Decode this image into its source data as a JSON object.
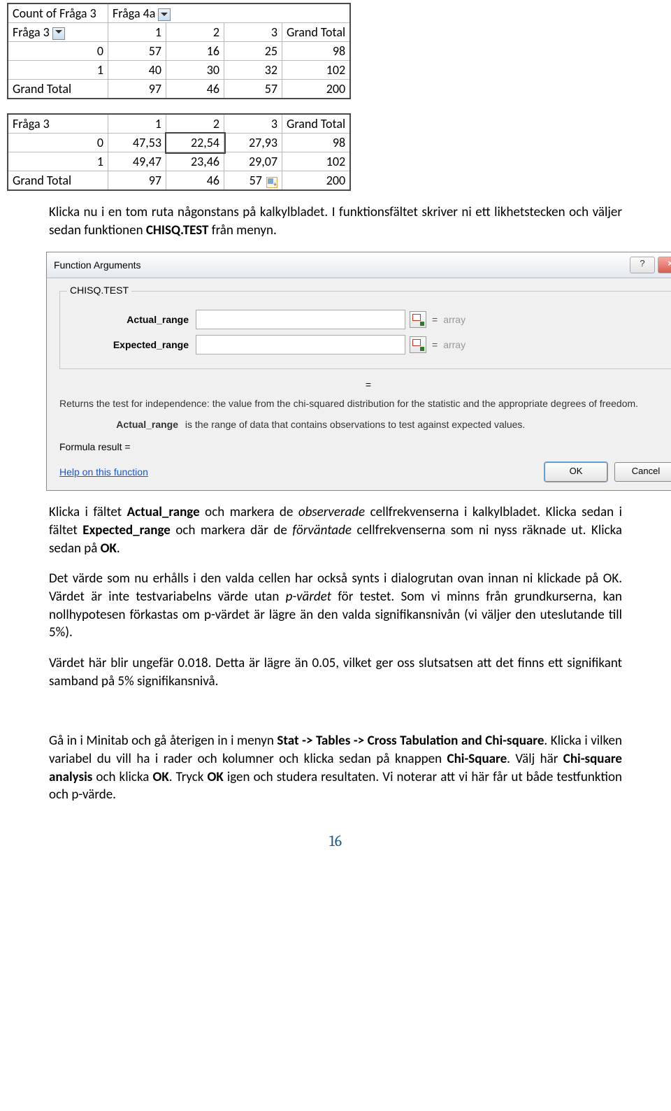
{
  "pivot1": {
    "r0": [
      "Count of Fråga 3",
      "Fråga 4a"
    ],
    "r1": [
      "Fråga 3",
      "1",
      "2",
      "3",
      "Grand Total"
    ],
    "rows": [
      [
        "0",
        "57",
        "16",
        "25",
        "98"
      ],
      [
        "1",
        "40",
        "30",
        "32",
        "102"
      ]
    ],
    "tot": [
      "Grand Total",
      "97",
      "46",
      "57",
      "200"
    ]
  },
  "pivot2": {
    "r1": [
      "Fråga 3",
      "1",
      "2",
      "3",
      "Grand Total"
    ],
    "rows": [
      [
        "0",
        "47,53",
        "22,54",
        "27,93",
        "98"
      ],
      [
        "1",
        "49,47",
        "23,46",
        "29,07",
        "102"
      ]
    ],
    "tot": [
      "Grand Total",
      "97",
      "46",
      "57",
      "200"
    ]
  },
  "para1_a": "Klicka nu i en tom ruta någonstans på kalkylbladet. I funktionsfältet skriver ni ett likhetstecken och väljer sedan funktionen ",
  "para1_b": "CHISQ.TEST",
  "para1_c": " från menyn.",
  "dialog": {
    "title": "Function Arguments",
    "help_icon": "?",
    "close_icon": "×",
    "fn": "CHISQ.TEST",
    "arg1_label": "Actual_range",
    "arg2_label": "Expected_range",
    "arg1_val": "",
    "arg2_val": "",
    "eq": "=",
    "array": "array",
    "eq2": "=",
    "desc_main": "Returns the test for independence: the value from the chi-squared distribution for the statistic and the appropriate degrees of freedom.",
    "desc_arg_name": "Actual_range",
    "desc_arg_text": "is the range of data that contains observations to test against expected values.",
    "formula_result_label": "Formula result =",
    "help_link": "Help on this function",
    "ok": "OK",
    "cancel": "Cancel"
  },
  "para2_a": "Klicka i fältet ",
  "para2_b": "Actual_range",
  "para2_c": " och markera de ",
  "para2_d": "observerade",
  "para2_e": " cellfrekvenserna i kalkylbladet. Klicka sedan i fältet ",
  "para2_f": "Expected_range",
  "para2_g": " och markera där de ",
  "para2_h": "förväntade",
  "para2_i": " cellfrekvenserna som ni nyss räknade ut. Klicka sedan på ",
  "para2_j": "OK",
  "para2_k": ".",
  "para3_a": "Det värde som nu erhålls i den valda cellen har också synts i dialogrutan ovan innan ni klickade på OK. Värdet är inte testvariabelns värde utan ",
  "para3_b": "p-värdet",
  "para3_c": " för testet. Som vi minns från grundkurserna, kan nollhypotesen förkastas om p-värdet är lägre än den valda signifikansnivån (vi väljer den uteslutande till 5%).",
  "para4": "Värdet här blir ungefär 0.018. Detta är lägre än 0.05, vilket ger oss slutsatsen att det finns ett signifikant samband på 5% signifikansnivå.",
  "para5_a": "Gå in i Minitab och gå återigen in i menyn ",
  "para5_b": "Stat -> Tables -> Cross Tabulation and Chi-square",
  "para5_c": ". Klicka i vilken variabel du vill ha i rader och kolumner och klicka sedan på knappen ",
  "para5_d": "Chi-Square",
  "para5_e": ". Välj här ",
  "para5_f": "Chi-square analysis",
  "para5_g": " och klicka ",
  "para5_h": "OK",
  "para5_i": ". Tryck ",
  "para5_j": "OK",
  "para5_k": " igen och studera resultaten. Vi noterar att vi här får ut både testfunktion och p-värde.",
  "pagenum": "16"
}
